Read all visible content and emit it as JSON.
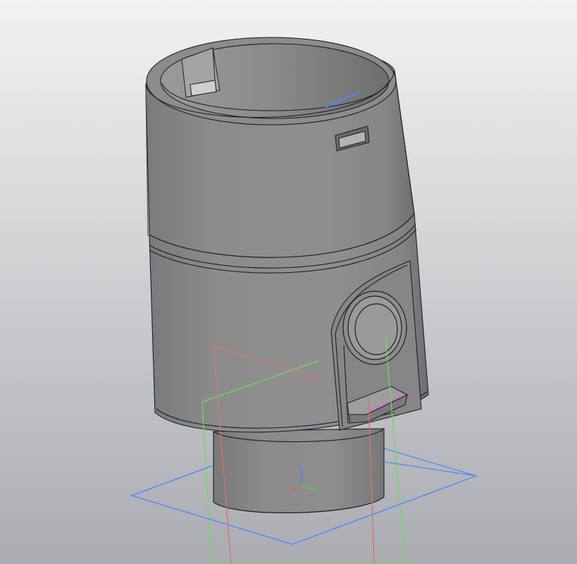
{
  "viewport": {
    "background_top": "#f1f2f3",
    "background_bottom": "#a9acb1"
  },
  "model": {
    "body_color": "#8a8a8a",
    "edge_color": "#1e1e1e"
  },
  "datum_planes": [
    {
      "name": "XY",
      "color": "#4d86ff"
    },
    {
      "name": "XZ",
      "color": "#e07070"
    },
    {
      "name": "YZ",
      "color": "#6fdc5a"
    }
  ],
  "triad": {
    "x_color": "#e06060",
    "y_color": "#50d050",
    "z_color": "#5080ff"
  }
}
